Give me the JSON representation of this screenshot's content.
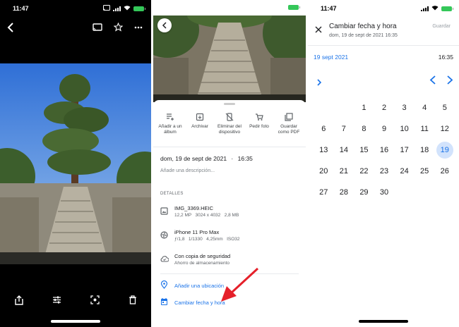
{
  "status": {
    "time": "11:47"
  },
  "details_panel": {
    "actions": [
      {
        "label": "Añadir a un álbum",
        "icon": "add-to-album-icon"
      },
      {
        "label": "Archivar",
        "icon": "archive-icon"
      },
      {
        "label": "Eliminar del dispositivo",
        "icon": "delete-from-device-icon"
      },
      {
        "label": "Pedir foto",
        "icon": "cart-icon"
      },
      {
        "label": "Guardar como PDF",
        "icon": "pdf-icon"
      }
    ],
    "date": "dom, 19 de sept de 2021",
    "time": "16:35",
    "separator": "·",
    "description_placeholder": "Añade una descripción...",
    "details_heading": "DETALLES",
    "file": {
      "name": "IMG_3369.HEIC",
      "info": "12,2 MP   3024 x 4032   2,8 MB"
    },
    "camera": {
      "model": "iPhone 11 Pro Max",
      "info": "ƒ/1,8   1/1330   4,25mm   ISO32"
    },
    "backup": {
      "title": "Con copia de seguridad",
      "subtitle": "Ahorro de almacenamiento"
    },
    "add_location": "Añadir una ubicación",
    "change_datetime": "Cambiar fecha y hora"
  },
  "date_picker": {
    "title": "Cambiar fecha y hora",
    "subtitle": "dom, 19 de sept de 2021 16:35",
    "save_label": "Guardar",
    "selected_date": "19 sept 2021",
    "selected_time": "16:35",
    "selected_day": "19",
    "weeks": [
      [
        "",
        "",
        "1",
        "2",
        "3",
        "4",
        "5"
      ],
      [
        "6",
        "7",
        "8",
        "9",
        "10",
        "11",
        "12"
      ],
      [
        "13",
        "14",
        "15",
        "16",
        "17",
        "18",
        "19"
      ],
      [
        "20",
        "21",
        "22",
        "23",
        "24",
        "25",
        "26"
      ],
      [
        "27",
        "28",
        "29",
        "30",
        "",
        "",
        ""
      ]
    ]
  },
  "colors": {
    "accent": "#1a73e8",
    "selected_bg": "#d2e3fc",
    "arrow": "#e5202a",
    "battery": "#34c759"
  }
}
